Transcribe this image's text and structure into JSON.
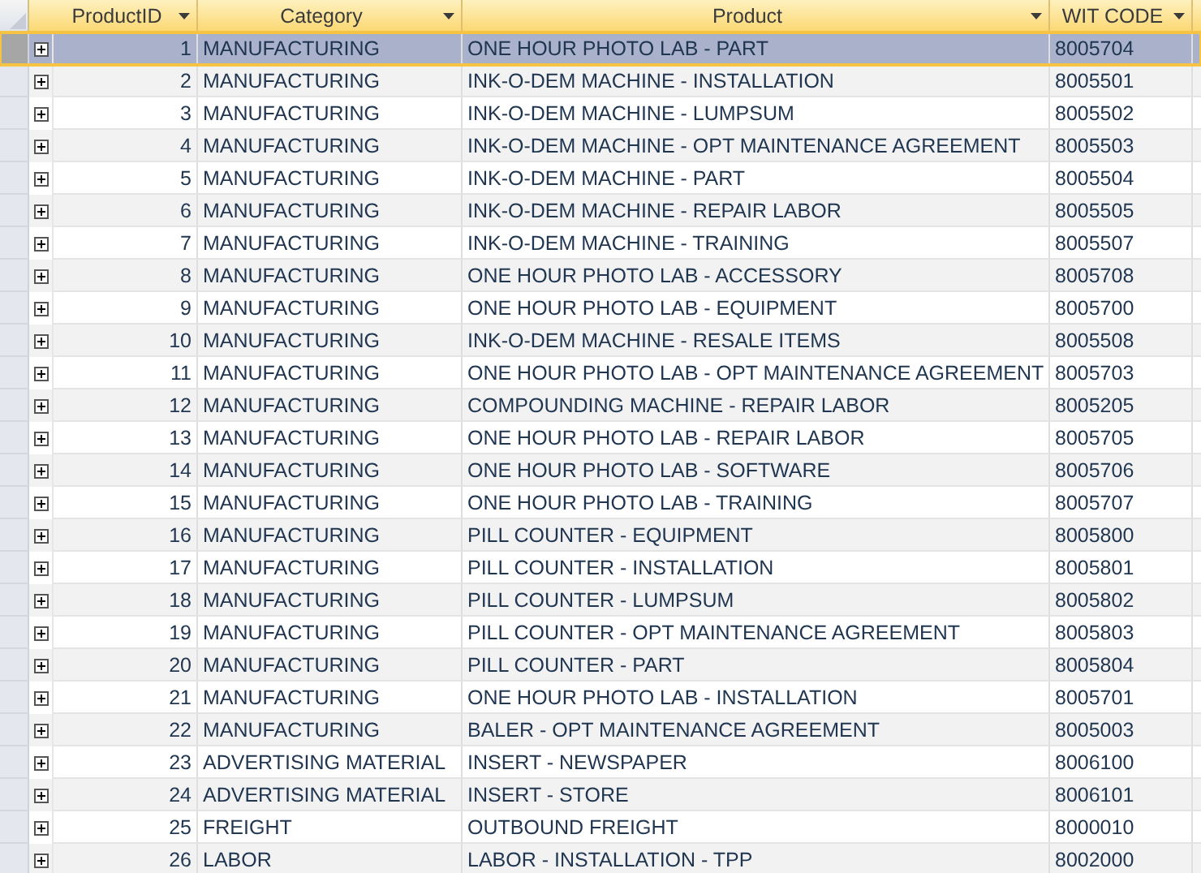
{
  "table": {
    "columns": [
      "ProductID",
      "Category",
      "Product",
      "WIT CODE"
    ],
    "rows": [
      {
        "id": "1",
        "category": "MANUFACTURING",
        "product": "ONE HOUR PHOTO LAB - PART",
        "code": "8005704",
        "selected": true
      },
      {
        "id": "2",
        "category": "MANUFACTURING",
        "product": "INK-O-DEM MACHINE - INSTALLATION",
        "code": "8005501",
        "selected": false
      },
      {
        "id": "3",
        "category": "MANUFACTURING",
        "product": "INK-O-DEM MACHINE - LUMPSUM",
        "code": "8005502",
        "selected": false
      },
      {
        "id": "4",
        "category": "MANUFACTURING",
        "product": "INK-O-DEM MACHINE - OPT MAINTENANCE AGREEMENT",
        "code": "8005503",
        "selected": false
      },
      {
        "id": "5",
        "category": "MANUFACTURING",
        "product": "INK-O-DEM MACHINE - PART",
        "code": "8005504",
        "selected": false
      },
      {
        "id": "6",
        "category": "MANUFACTURING",
        "product": "INK-O-DEM MACHINE - REPAIR LABOR",
        "code": "8005505",
        "selected": false
      },
      {
        "id": "7",
        "category": "MANUFACTURING",
        "product": "INK-O-DEM MACHINE - TRAINING",
        "code": "8005507",
        "selected": false
      },
      {
        "id": "8",
        "category": "MANUFACTURING",
        "product": "ONE HOUR PHOTO LAB - ACCESSORY",
        "code": "8005708",
        "selected": false
      },
      {
        "id": "9",
        "category": "MANUFACTURING",
        "product": "ONE HOUR PHOTO LAB - EQUIPMENT",
        "code": "8005700",
        "selected": false
      },
      {
        "id": "10",
        "category": "MANUFACTURING",
        "product": "INK-O-DEM MACHINE - RESALE ITEMS",
        "code": "8005508",
        "selected": false
      },
      {
        "id": "11",
        "category": "MANUFACTURING",
        "product": "ONE HOUR PHOTO LAB - OPT MAINTENANCE AGREEMENT",
        "code": "8005703",
        "selected": false
      },
      {
        "id": "12",
        "category": "MANUFACTURING",
        "product": "COMPOUNDING MACHINE - REPAIR LABOR",
        "code": "8005205",
        "selected": false
      },
      {
        "id": "13",
        "category": "MANUFACTURING",
        "product": "ONE HOUR PHOTO LAB - REPAIR LABOR",
        "code": "8005705",
        "selected": false
      },
      {
        "id": "14",
        "category": "MANUFACTURING",
        "product": "ONE HOUR PHOTO LAB - SOFTWARE",
        "code": "8005706",
        "selected": false
      },
      {
        "id": "15",
        "category": "MANUFACTURING",
        "product": "ONE HOUR PHOTO LAB - TRAINING",
        "code": "8005707",
        "selected": false
      },
      {
        "id": "16",
        "category": "MANUFACTURING",
        "product": "PILL COUNTER - EQUIPMENT",
        "code": "8005800",
        "selected": false
      },
      {
        "id": "17",
        "category": "MANUFACTURING",
        "product": "PILL COUNTER - INSTALLATION",
        "code": "8005801",
        "selected": false
      },
      {
        "id": "18",
        "category": "MANUFACTURING",
        "product": "PILL COUNTER - LUMPSUM",
        "code": "8005802",
        "selected": false
      },
      {
        "id": "19",
        "category": "MANUFACTURING",
        "product": "PILL COUNTER - OPT MAINTENANCE AGREEMENT",
        "code": "8005803",
        "selected": false
      },
      {
        "id": "20",
        "category": "MANUFACTURING",
        "product": "PILL COUNTER - PART",
        "code": "8005804",
        "selected": false
      },
      {
        "id": "21",
        "category": "MANUFACTURING",
        "product": "ONE HOUR PHOTO LAB - INSTALLATION",
        "code": "8005701",
        "selected": false
      },
      {
        "id": "22",
        "category": "MANUFACTURING",
        "product": "BALER - OPT MAINTENANCE AGREEMENT",
        "code": "8005003",
        "selected": false
      },
      {
        "id": "23",
        "category": "ADVERTISING MATERIAL",
        "product": "INSERT - NEWSPAPER",
        "code": "8006100",
        "selected": false
      },
      {
        "id": "24",
        "category": "ADVERTISING MATERIAL",
        "product": "INSERT - STORE",
        "code": "8006101",
        "selected": false
      },
      {
        "id": "25",
        "category": "FREIGHT",
        "product": "OUTBOUND FREIGHT",
        "code": "8000010",
        "selected": false
      },
      {
        "id": "26",
        "category": "LABOR",
        "product": "LABOR - INSTALLATION - TPP",
        "code": "8002000",
        "selected": false
      }
    ]
  }
}
